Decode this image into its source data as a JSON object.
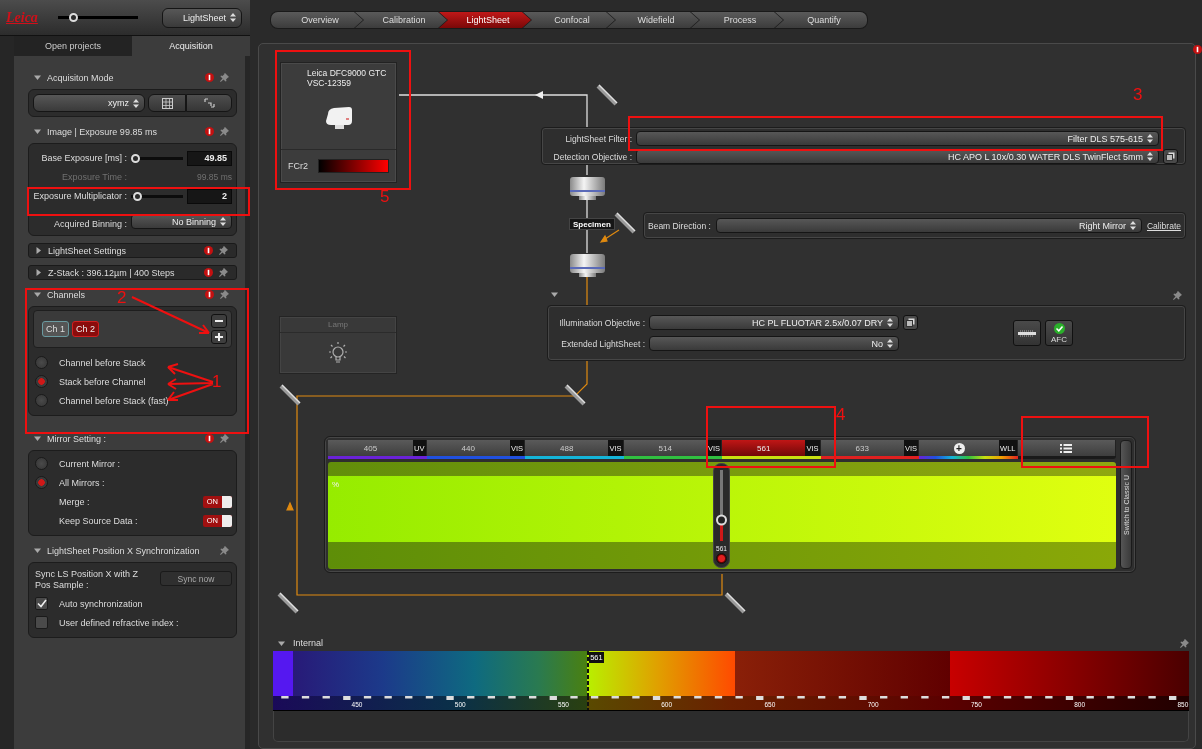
{
  "header": {
    "logo": "Leica",
    "zoom_slider": {
      "level": 0.15
    },
    "perspective": "LightSheet"
  },
  "nav_steps": [
    {
      "label": "Overview",
      "selected": false
    },
    {
      "label": "Calibration",
      "selected": false
    },
    {
      "label": "LightSheet",
      "selected": true
    },
    {
      "label": "Confocal",
      "selected": false
    },
    {
      "label": "Widefield",
      "selected": false
    },
    {
      "label": "Process",
      "selected": false
    },
    {
      "label": "Quantify",
      "selected": false
    }
  ],
  "sidebar": {
    "tabs": [
      {
        "label": "Open projects",
        "selected": false
      },
      {
        "label": "Acquisition",
        "selected": true
      }
    ],
    "sections": [
      {
        "kind": "mode",
        "title": "Acquisiton Mode",
        "expanded": true,
        "alert": true,
        "mode": "xymz"
      },
      {
        "kind": "image",
        "title": "Image | Exposure 99.85 ms",
        "expanded": true,
        "alert": true,
        "base_exposure": {
          "label": "Base Exposure [ms] :",
          "level": 0.0,
          "value": "49.85"
        },
        "exposure_time": {
          "label": "Exposure Time :",
          "value": "99.85 ms",
          "disabled": true
        },
        "multiplicator": {
          "label": "Exposure Multiplicator :",
          "level": 0.05,
          "value": "2"
        },
        "binning": {
          "label": "Acquired Binning :",
          "value": "No Binning"
        }
      },
      {
        "kind": "plain",
        "title": "LightSheet Settings",
        "expanded": false,
        "alert": true
      },
      {
        "kind": "plain",
        "title": "Z-Stack : 396.12µm | 400 Steps",
        "expanded": false,
        "alert": true
      },
      {
        "kind": "channels",
        "title": "Channels",
        "expanded": true,
        "alert": true,
        "channels": [
          {
            "label": "Ch 1",
            "selected": false
          },
          {
            "label": "Ch 2",
            "selected": true
          }
        ],
        "order": [
          {
            "label": "Channel before Stack",
            "selected": false
          },
          {
            "label": "Stack before Channel",
            "selected": true
          },
          {
            "label": "Channel before Stack (fast)",
            "selected": false
          }
        ]
      },
      {
        "kind": "mirror",
        "title": "Mirror Setting :",
        "expanded": true,
        "alert": true,
        "options": [
          {
            "label": "Current Mirror :",
            "selected": false
          },
          {
            "label": "All Mirrors :",
            "selected": true
          }
        ],
        "toggles": [
          {
            "label": "Merge :",
            "on": true,
            "text": "ON"
          },
          {
            "label": "Keep Source Data :",
            "on": true,
            "text": "ON"
          }
        ]
      },
      {
        "kind": "sync",
        "title": "LightSheet Position X Synchronization",
        "expanded": true,
        "alert": false,
        "text": "Sync LS Position X with Z Pos Sample :",
        "button": "Sync now",
        "disabled": true,
        "checks": [
          {
            "label": "Auto synchronization",
            "checked": true
          },
          {
            "label": "User defined refractive index :",
            "checked": false
          }
        ]
      }
    ]
  },
  "canvas": {
    "alert": true,
    "camera": {
      "lines": [
        "Leica DFC9000 GTC",
        "VSC-12359"
      ],
      "lut": "FCr2"
    },
    "lamp": {
      "label": "Lamp"
    },
    "detection": [
      {
        "label": "LightSheet Filter :",
        "value": "Filter DLS 575-615"
      },
      {
        "label": "Detection Objective :",
        "value": "HC APO L   10x/0.30 WATER  DLS TwinFlect 5mm"
      }
    ],
    "specimen": "Specimen",
    "beam": {
      "label": "Beam Direction :",
      "value": "Right Mirror",
      "link": "Calibrate"
    },
    "illumination": [
      {
        "label": "Illumination Objective :",
        "value": "HC PL FLUOTAR  2.5x/0.07 DRY"
      },
      {
        "label": "Extended LightSheet :",
        "value": "No"
      }
    ],
    "afc": "AFC",
    "lasers": [
      {
        "kind": "laser",
        "label": "405",
        "tag": "UV",
        "color": "#6a22d8",
        "selected": false
      },
      {
        "kind": "laser",
        "label": "440",
        "tag": "VIS",
        "color": "#2050e0",
        "selected": false
      },
      {
        "kind": "laser",
        "label": "488",
        "tag": "VIS",
        "color": "#14b4d8",
        "selected": false
      },
      {
        "kind": "laser",
        "label": "514",
        "tag": "VIS",
        "color": "#30c040",
        "selected": false
      },
      {
        "kind": "laser",
        "label": "561",
        "tag": "VIS",
        "color": "#c8e010",
        "selected": true
      },
      {
        "kind": "laser",
        "label": "633",
        "tag": "VIS",
        "color": "#e02020",
        "selected": false
      },
      {
        "kind": "add",
        "label": "+",
        "tag": "WLL"
      },
      {
        "kind": "menu"
      }
    ],
    "laser_power": {
      "label": "561",
      "level": 0.3,
      "unit": "%"
    },
    "switch_ui": "Switch to Classic U",
    "spectrum": {
      "title": "Internal",
      "marker": "561",
      "ticks": [
        "450",
        "500",
        "550",
        "600",
        "650",
        "700",
        "750",
        "800",
        "850"
      ]
    }
  },
  "annotations": [
    {
      "label": "1"
    },
    {
      "label": "2"
    },
    {
      "label": "3"
    },
    {
      "label": "4"
    },
    {
      "label": "5"
    }
  ]
}
